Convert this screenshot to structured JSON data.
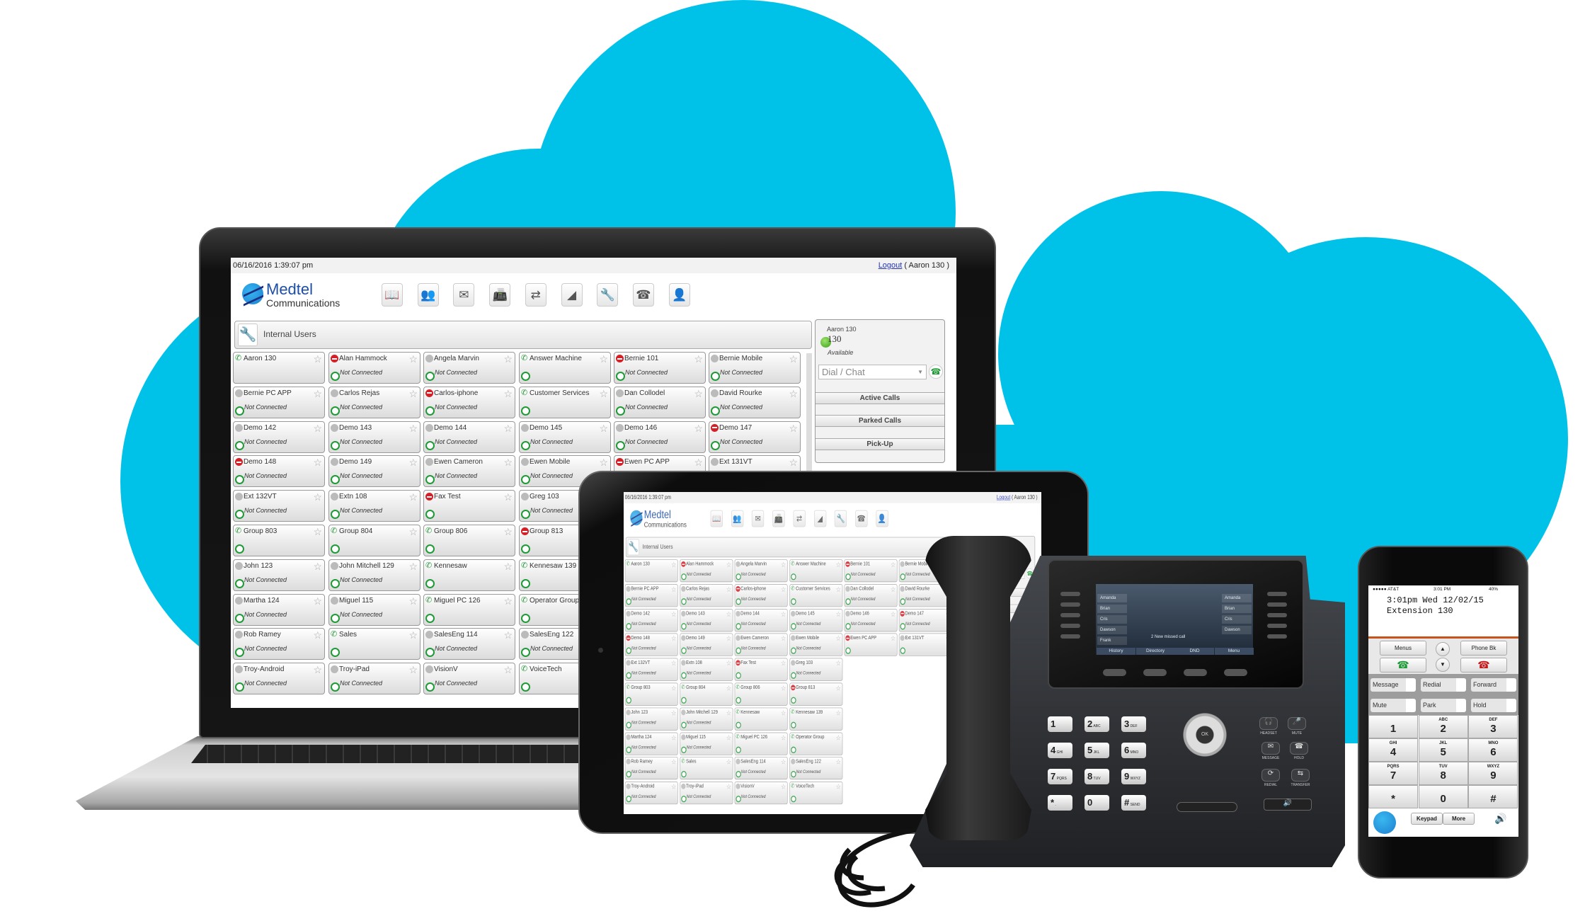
{
  "colors": {
    "cloud": "#00c2e8",
    "brand_blue": "#1d4ea6",
    "online_green": "#1e9a36",
    "dnd_red": "#d41f26"
  },
  "app": {
    "datetime": "06/16/2016  1:39:07 pm",
    "logout_label": "Logout",
    "logged_in_user": "( Aaron 130 )",
    "logo": {
      "name": "Medtel",
      "tagline": "Communications"
    },
    "toolbar_icons": [
      "directory-book-icon",
      "conference-icon",
      "voicemail-icon",
      "fax-icon",
      "call-transfer-icon",
      "reports-chart-icon",
      "settings-wrench-icon",
      "desk-phone-icon",
      "user-profile-icon"
    ],
    "section_title": "Internal Users",
    "users_rows": [
      [
        {
          "name": "Aaron 130",
          "presence": "phone",
          "chat": false,
          "connection": ""
        },
        {
          "name": "Alan Hammock",
          "presence": "dnd",
          "chat": true,
          "connection": "Not Connected"
        },
        {
          "name": "Angela Marvin",
          "presence": "offline",
          "chat": true,
          "connection": "Not Connected"
        },
        {
          "name": "Answer Machine",
          "presence": "phone",
          "chat": true,
          "connection": ""
        },
        {
          "name": "Bernie 101",
          "presence": "dnd",
          "chat": true,
          "connection": "Not Connected"
        },
        {
          "name": "Bernie Mobile",
          "presence": "offline",
          "chat": true,
          "connection": "Not Connected"
        }
      ],
      [
        {
          "name": "Bernie PC APP",
          "presence": "offline",
          "chat": true,
          "connection": "Not Connected"
        },
        {
          "name": "Carlos Rejas",
          "presence": "offline",
          "chat": true,
          "connection": "Not Connected"
        },
        {
          "name": "Carlos-iphone",
          "presence": "dnd",
          "chat": true,
          "connection": "Not Connected"
        },
        {
          "name": "Customer Services",
          "presence": "phone",
          "chat": true,
          "connection": ""
        },
        {
          "name": "Dan Collodel",
          "presence": "offline",
          "chat": true,
          "connection": "Not Connected"
        },
        {
          "name": "David Rourke",
          "presence": "offline",
          "chat": true,
          "connection": "Not Connected"
        }
      ],
      [
        {
          "name": "Demo 142",
          "presence": "offline",
          "chat": true,
          "connection": "Not Connected"
        },
        {
          "name": "Demo 143",
          "presence": "offline",
          "chat": true,
          "connection": "Not Connected"
        },
        {
          "name": "Demo 144",
          "presence": "offline",
          "chat": true,
          "connection": "Not Connected"
        },
        {
          "name": "Demo 145",
          "presence": "offline",
          "chat": true,
          "connection": "Not Connected"
        },
        {
          "name": "Demo 146",
          "presence": "offline",
          "chat": true,
          "connection": "Not Connected"
        },
        {
          "name": "Demo 147",
          "presence": "dnd",
          "chat": true,
          "connection": "Not Connected"
        }
      ],
      [
        {
          "name": "Demo 148",
          "presence": "dnd",
          "chat": true,
          "connection": "Not Connected"
        },
        {
          "name": "Demo 149",
          "presence": "offline",
          "chat": true,
          "connection": "Not Connected"
        },
        {
          "name": "Ewen Cameron",
          "presence": "offline",
          "chat": true,
          "connection": "Not Connected"
        },
        {
          "name": "Ewen Mobile",
          "presence": "offline",
          "chat": true,
          "connection": "Not Connected"
        },
        {
          "name": "Ewen PC APP",
          "presence": "dnd",
          "chat": true,
          "connection": ""
        },
        {
          "name": "Ext 131VT",
          "presence": "offline",
          "chat": true,
          "connection": ""
        }
      ],
      [
        {
          "name": "Ext 132VT",
          "presence": "offline",
          "chat": true,
          "connection": "Not Connected"
        },
        {
          "name": "Extn 108",
          "presence": "offline",
          "chat": true,
          "connection": "Not Connected"
        },
        {
          "name": "Fax Test",
          "presence": "dnd",
          "chat": true,
          "connection": ""
        },
        {
          "name": "Greg 103",
          "presence": "offline",
          "chat": true,
          "connection": "Not Connected"
        }
      ],
      [
        {
          "name": "Group 803",
          "presence": "phone",
          "chat": true,
          "connection": ""
        },
        {
          "name": "Group 804",
          "presence": "phone",
          "chat": true,
          "connection": ""
        },
        {
          "name": "Group 806",
          "presence": "phone",
          "chat": true,
          "connection": ""
        },
        {
          "name": "Group 813",
          "presence": "dnd",
          "chat": true,
          "connection": ""
        }
      ],
      [
        {
          "name": "John 123",
          "presence": "offline",
          "chat": true,
          "connection": "Not Connected"
        },
        {
          "name": "John Mitchell 129",
          "presence": "offline",
          "chat": true,
          "connection": "Not Connected"
        },
        {
          "name": "Kennesaw",
          "presence": "phone",
          "chat": true,
          "connection": ""
        },
        {
          "name": "Kennesaw 139",
          "presence": "phone",
          "chat": true,
          "connection": ""
        }
      ],
      [
        {
          "name": "Martha 124",
          "presence": "offline",
          "chat": true,
          "connection": "Not Connected"
        },
        {
          "name": "Miguel 115",
          "presence": "offline",
          "chat": true,
          "connection": "Not Connected"
        },
        {
          "name": "Miguel PC 126",
          "presence": "phone",
          "chat": true,
          "connection": ""
        },
        {
          "name": "Operator Group",
          "presence": "phone",
          "chat": true,
          "connection": ""
        }
      ],
      [
        {
          "name": "Rob Ramey",
          "presence": "offline",
          "chat": true,
          "connection": "Not Connected"
        },
        {
          "name": "Sales",
          "presence": "phone",
          "chat": true,
          "connection": ""
        },
        {
          "name": "SalesEng 114",
          "presence": "offline",
          "chat": true,
          "connection": "Not Connected"
        },
        {
          "name": "SalesEng 122",
          "presence": "offline",
          "chat": true,
          "connection": "Not Connected"
        }
      ],
      [
        {
          "name": "Troy-Android",
          "presence": "offline",
          "chat": true,
          "connection": "Not Connected"
        },
        {
          "name": "Troy-iPad",
          "presence": "offline",
          "chat": true,
          "connection": "Not Connected"
        },
        {
          "name": "VisionV",
          "presence": "offline",
          "chat": true,
          "connection": "Not Connected"
        },
        {
          "name": "VoiceTech",
          "presence": "phone",
          "chat": true,
          "connection": ""
        }
      ]
    ],
    "panel": {
      "user_name": "Aaron 130",
      "extension": "130",
      "status": "Available",
      "dial_placeholder": "Dial / Chat",
      "buttons": [
        "Active Calls",
        "Parked Calls",
        "Pick-Up"
      ]
    }
  },
  "desk_phone": {
    "left_contacts": [
      "Amanda",
      "Brian",
      "Cris",
      "Dawson",
      "Frank"
    ],
    "right_contacts": [
      "Amanda",
      "Brian",
      "Cris",
      "Dawson"
    ],
    "notice": "2 New missed call",
    "softkeys": [
      "History",
      "Directory",
      "DND",
      "Menu"
    ],
    "keys": [
      {
        "d": "1",
        "l": ""
      },
      {
        "d": "2",
        "l": "ABC"
      },
      {
        "d": "3",
        "l": "DEF"
      },
      {
        "d": "4",
        "l": "GHI"
      },
      {
        "d": "5",
        "l": "JKL"
      },
      {
        "d": "6",
        "l": "MNO"
      },
      {
        "d": "7",
        "l": "PQRS"
      },
      {
        "d": "8",
        "l": "TUV"
      },
      {
        "d": "9",
        "l": "WXYZ"
      },
      {
        "d": "*",
        "l": "."
      },
      {
        "d": "0",
        "l": ""
      },
      {
        "d": "#",
        "l": "SEND"
      }
    ],
    "ok_label": "OK",
    "function_buttons": [
      "HEADSET",
      "MUTE",
      "MESSAGE",
      "HOLD",
      "REDIAL",
      "TRANSFER"
    ]
  },
  "mobile": {
    "carrier": "●●●●● AT&T",
    "time": "3:01 PM",
    "battery": "40%",
    "line1": "3:01pm Wed   12/02/15",
    "line2": "Extension 130",
    "menus": "Menus",
    "phonebook": "Phone Bk",
    "functions": [
      "Message",
      "Redial",
      "Forward",
      "Mute",
      "Park",
      "Hold"
    ],
    "keys": [
      {
        "d": "1",
        "l": ""
      },
      {
        "d": "2",
        "l": "ABC"
      },
      {
        "d": "3",
        "l": "DEF"
      },
      {
        "d": "4",
        "l": "GHI"
      },
      {
        "d": "5",
        "l": "JKL"
      },
      {
        "d": "6",
        "l": "MNO"
      },
      {
        "d": "7",
        "l": "PQRS"
      },
      {
        "d": "8",
        "l": "TUV"
      },
      {
        "d": "9",
        "l": "WXYZ"
      },
      {
        "d": "*",
        "l": ""
      },
      {
        "d": "0",
        "l": ""
      },
      {
        "d": "#",
        "l": ""
      }
    ],
    "tabs": [
      "Keypad",
      "More"
    ]
  }
}
